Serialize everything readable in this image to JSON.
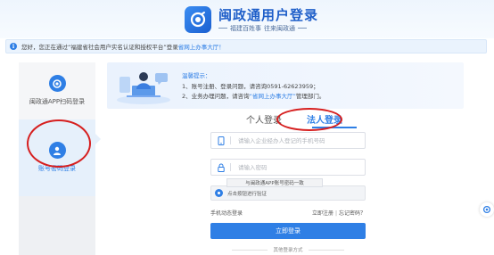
{
  "header": {
    "title": "闽政通用户登录",
    "slogan_left": "福建百姓事",
    "slogan_right": "往来闽政通"
  },
  "notice": {
    "text": "您好，您正在通过“福建省社会用户实名认证和授权平台”登录",
    "link": "省网上办事大厅！"
  },
  "sidebar": {
    "items": [
      {
        "label": "闽政通APP扫码登录",
        "icon": "app-logo-icon",
        "active": false
      },
      {
        "label": "账号密码登录",
        "icon": "user-icon",
        "active": true
      }
    ]
  },
  "tips": {
    "title": "温馨提示：",
    "line1": "1、账号注册、登录问题，请咨询0591-62623959；",
    "line2_prefix": "2、业务办理问题，请咨询",
    "line2_link": "“省网上办事大厅”",
    "line2_suffix": "管理部门。"
  },
  "tabs": [
    {
      "label": "个人登录",
      "active": false
    },
    {
      "label": "法人登录",
      "active": true
    }
  ],
  "form": {
    "phone_placeholder": "请输入企业经办人登记的手机号码",
    "password_placeholder": "请输入密码",
    "tooltip": "与闽政通APP账号密码一致",
    "verify_text": "点击按钮进行验证",
    "mobile_login": "手机动态登录",
    "register": "立即注册",
    "forgot": "忘记密码？",
    "login_button": "立即登录",
    "other_methods": "其他登录方式"
  },
  "colors": {
    "accent": "#2f7fe5",
    "annotation": "#d61f1f"
  }
}
